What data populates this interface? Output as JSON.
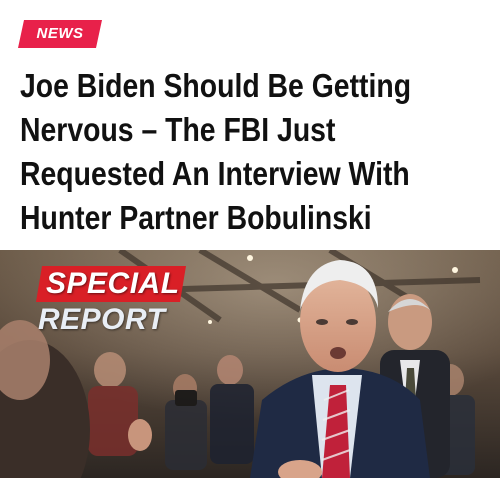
{
  "tag": {
    "label": "NEWS",
    "color": "#e8214a"
  },
  "headline": {
    "lines": [
      "Joe Biden Should Be Getting",
      "Nervous – The FBI Just",
      "Requested An Interview With",
      "Hunter Partner Bobulinski"
    ]
  },
  "banner": {
    "line1": "SPECIAL",
    "line2": "REPORT",
    "color": "#d91f26"
  }
}
